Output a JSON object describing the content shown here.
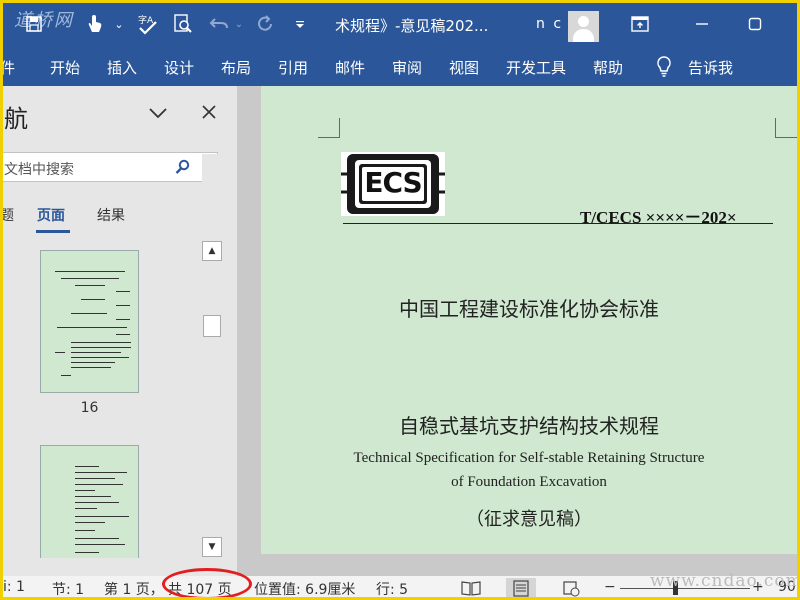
{
  "titlebar": {
    "watermark": "道桥网",
    "doc_title": "术规程》-意见稿202...",
    "user": "n c",
    "quick_access": [
      "save-icon",
      "touch-mode-icon",
      "spelling-icon",
      "find-icon",
      "undo-icon",
      "redo-icon",
      "customize-icon"
    ]
  },
  "ribbon": {
    "tabs": [
      "件",
      "开始",
      "插入",
      "设计",
      "布局",
      "引用",
      "邮件",
      "审阅",
      "视图",
      "开发工具",
      "帮助"
    ],
    "tell_me": "告诉我"
  },
  "nav": {
    "title": "航",
    "search_placeholder": "文档中搜索",
    "tabs": [
      "题",
      "页面",
      "结果"
    ],
    "active_tab": "页面",
    "thumb_pages": [
      "16"
    ]
  },
  "document": {
    "logo": "ECS",
    "standard_no": "T/CECS ××××－202×",
    "org": "中国工程建设标准化协会标准",
    "title_zh": "自稳式基坑支护结构技术规程",
    "title_en_1": "Technical Specification for Self-stable Retaining Structure",
    "title_en_2": "of Foundation Excavation",
    "draft": "（征求意见稿）"
  },
  "status": {
    "col": "i: 1",
    "section": "节: 1",
    "page": "第 1 页，",
    "total": "共 107 页",
    "position": "位置值: 6.9厘米",
    "line": "行: 5",
    "zoom": "90"
  },
  "site_watermark": "www.cndao.com",
  "colors": {
    "ribbon": "#2b579a",
    "page": "#cfe8cf",
    "highlight": "#e02020",
    "frame": "#f0d000"
  }
}
